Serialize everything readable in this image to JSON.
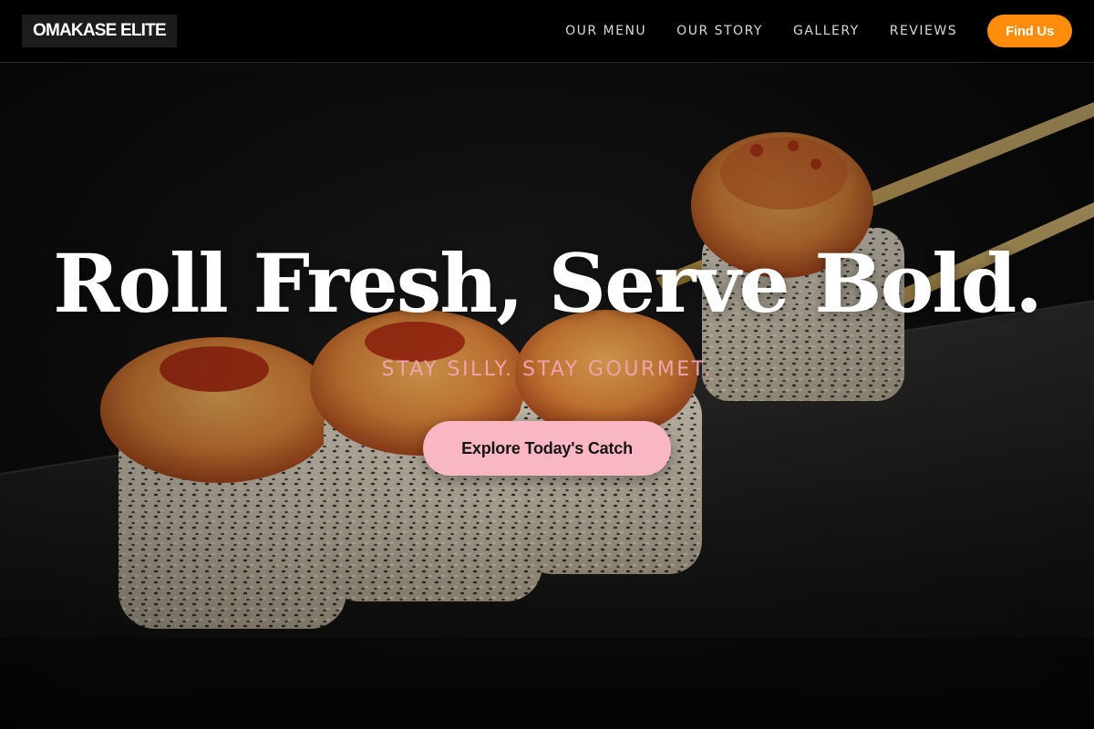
{
  "header": {
    "logo": "OMAKASE ELITE",
    "nav": [
      {
        "label": "OUR MENU"
      },
      {
        "label": "OUR STORY"
      },
      {
        "label": "GALLERY"
      },
      {
        "label": "REVIEWS"
      }
    ],
    "cta_label": "Find Us"
  },
  "hero": {
    "title": "Roll Fresh, Serve Bold.",
    "subtitle": "STAY SILLY. STAY GOURMET.",
    "cta_label": "Explore Today's Catch",
    "image_subject": "sushi-rolls-with-chopsticks"
  },
  "colors": {
    "header_bg": "#000000",
    "accent_orange": "#ff8c0a",
    "cta_pink": "#f9b7c3",
    "subtitle_pink": "#f2a2ac"
  }
}
